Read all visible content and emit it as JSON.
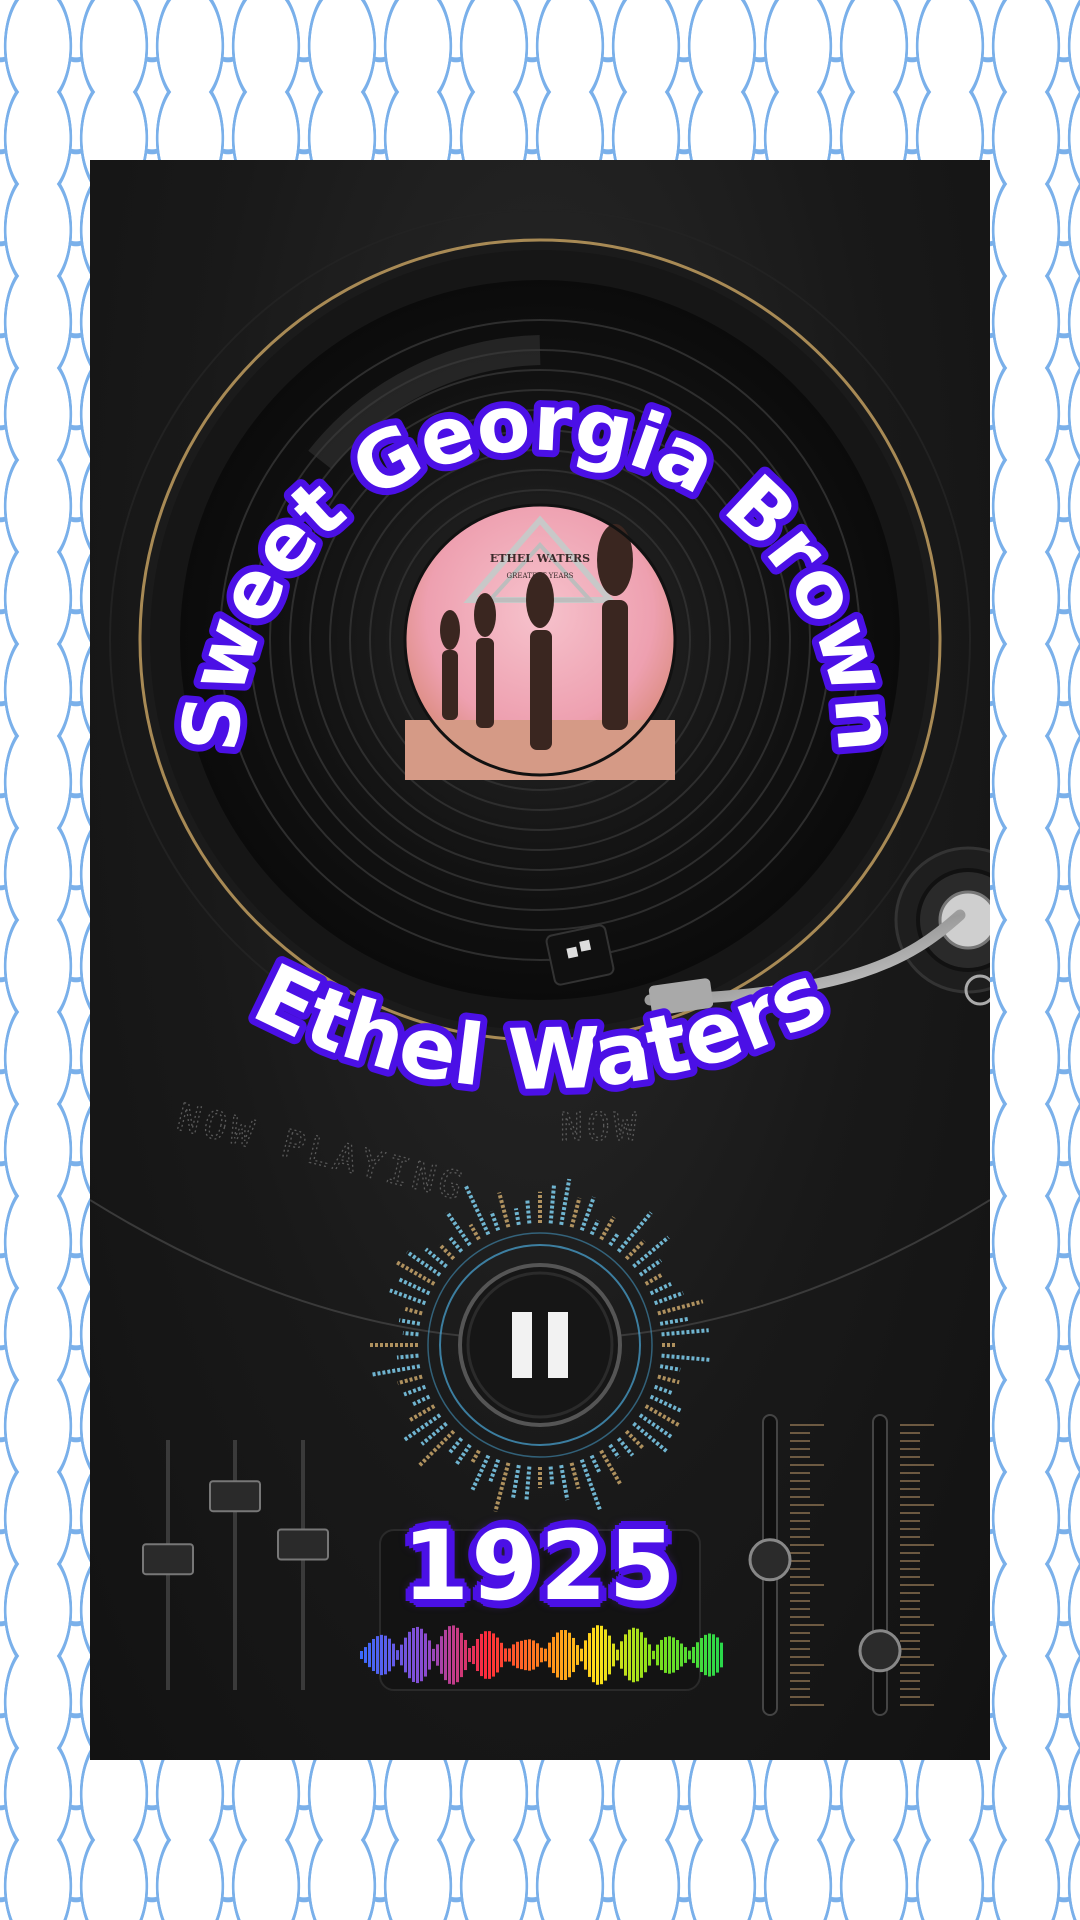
{
  "track": {
    "title": "Sweet Georgia Brown",
    "artist": "Ethel Waters",
    "year": "1925"
  },
  "album_label": {
    "artist": "ETHEL WATERS",
    "subtitle": "GREATEST YEARS"
  },
  "backdrop_text": {
    "left": "NOW PLAYING",
    "right": "NOW"
  },
  "playback": {
    "state": "playing",
    "control_icon": "pause-icon"
  },
  "mixer": {
    "vertical_faders": [
      0.48,
      0.78,
      0.55
    ],
    "right_sliders": [
      0.52,
      0.17
    ]
  },
  "colors": {
    "text_outline": "#4b10e6",
    "record_label_pink": "#f0a4b4",
    "tonearm_gold": "#c9a66b"
  }
}
